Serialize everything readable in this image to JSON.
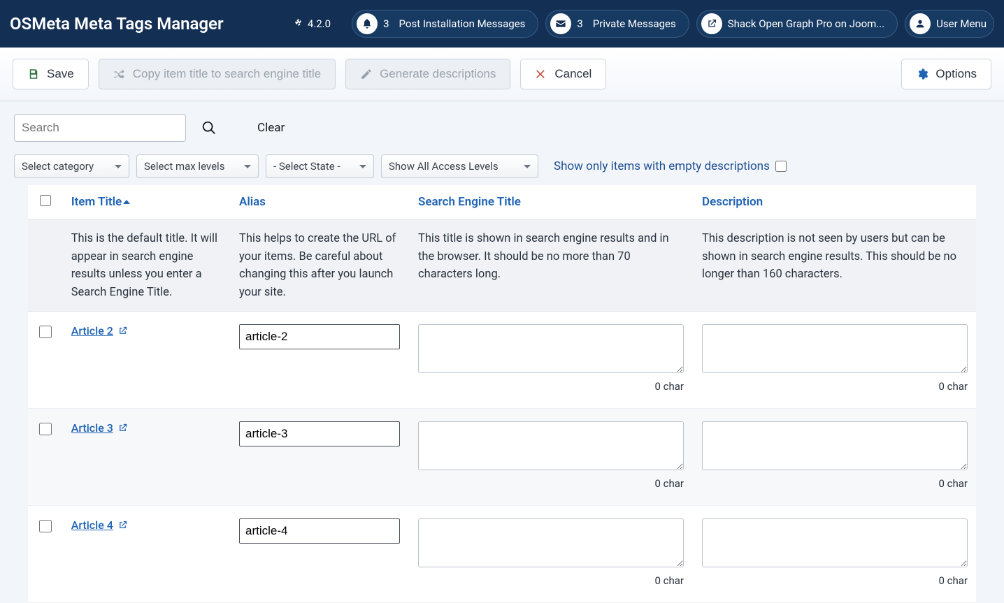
{
  "header": {
    "title": "OSMeta Meta Tags Manager",
    "joomla_version": "4.2.0",
    "pills": {
      "post_install": {
        "count": "3",
        "label": "Post Installation Messages"
      },
      "private_msgs": {
        "count": "3",
        "label": "Private Messages"
      },
      "shack_og": {
        "label": "Shack Open Graph Pro on Joom..."
      },
      "user_menu": {
        "label": "User Menu"
      }
    }
  },
  "toolbar": {
    "save": "Save",
    "copy_title": "Copy item title to search engine title",
    "generate": "Generate descriptions",
    "cancel": "Cancel",
    "options": "Options"
  },
  "filters": {
    "search_placeholder": "Search",
    "clear": "Clear",
    "category": "Select category",
    "max_levels": "Select max levels",
    "state": "- Select State -",
    "access": "Show All Access Levels",
    "show_empty": "Show only items with empty descriptions"
  },
  "columns": {
    "item_title": "Item Title",
    "alias": "Alias",
    "seo_title": "Search Engine Title",
    "description": "Description"
  },
  "column_descriptions": {
    "item_title": "This is the default title. It will appear in search engine results unless you enter a Search Engine Title.",
    "alias": "This helps to create the URL of your items. Be careful about changing this after you launch your site.",
    "seo_title": "This title is shown in search engine results and in the browser. It should be no more than 70 characters long.",
    "description": "This description is not seen by users but can be shown in search engine results. This should be no longer than 160 characters."
  },
  "char_label": "0 char",
  "rows": [
    {
      "title": "Article 2",
      "alias": "article-2",
      "seo_title": "",
      "description": ""
    },
    {
      "title": "Article 3",
      "alias": "article-3",
      "seo_title": "",
      "description": ""
    },
    {
      "title": "Article 4",
      "alias": "article-4",
      "seo_title": "",
      "description": ""
    }
  ]
}
